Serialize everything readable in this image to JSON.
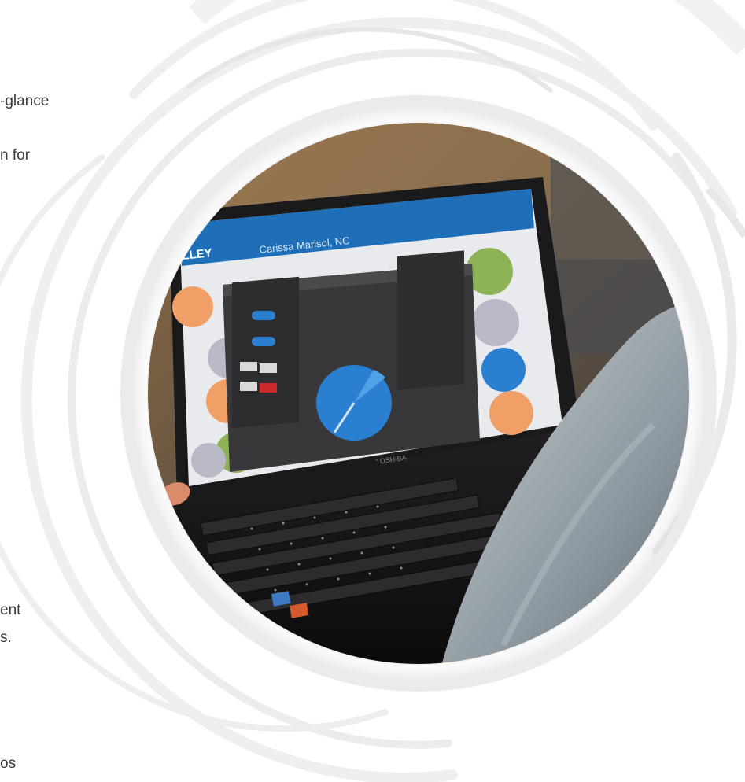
{
  "side_text": {
    "line_glance": "-glance",
    "line_for": "n for",
    "line_ent": "ent",
    "line_s": "s.",
    "line_os": "os"
  },
  "laptop_screen": {
    "brand_logo": "LLEY",
    "header_text": "Carissa Marisol, NC",
    "device_brand": "TOSHIBA"
  },
  "colors": {
    "swirl": "#eeeeee",
    "app_header": "#1f6fb8",
    "pie_blue": "#2a7fd0",
    "pie_green": "#8db356",
    "pie_orange": "#f0a066",
    "pie_gray": "#b9b9c8"
  }
}
